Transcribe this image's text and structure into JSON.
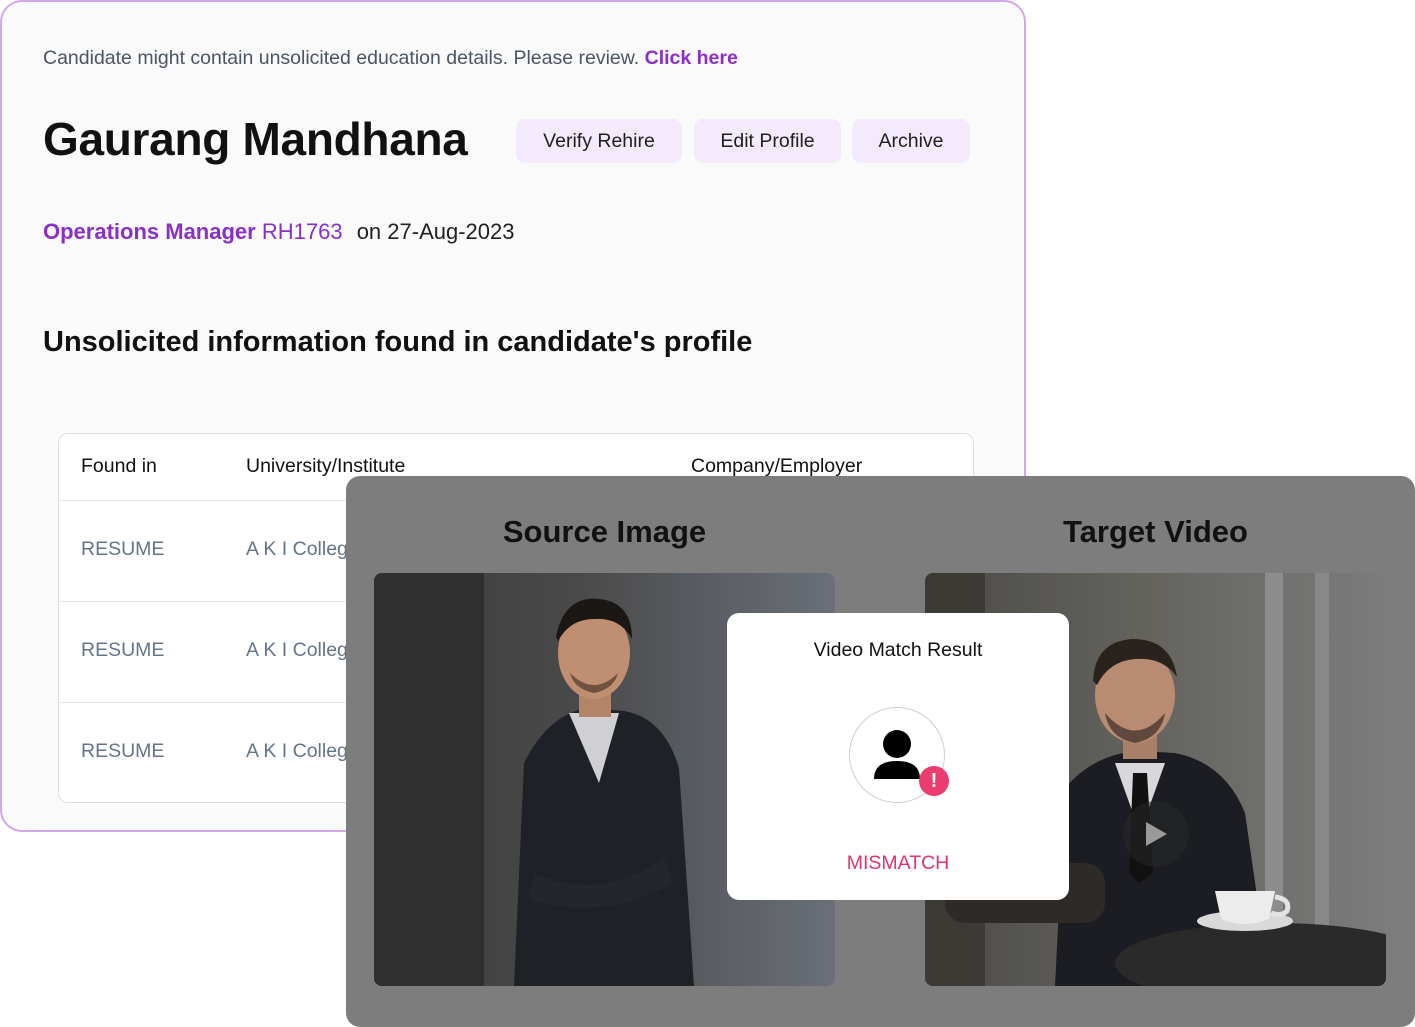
{
  "notice": {
    "text": "Candidate might contain unsolicited education details. Please review.",
    "link": "Click here"
  },
  "candidate": {
    "name": "Gaurang Mandhana",
    "job_title": "Operations Manager",
    "req_id": "RH1763",
    "date": "on 27-Aug-2023"
  },
  "actions": {
    "verify": "Verify Rehire",
    "edit": "Edit Profile",
    "archive": "Archive"
  },
  "section_title": "Unsolicited information found in candidate's profile",
  "table": {
    "headers": [
      "Found in",
      "University/Institute",
      "Company/Employer"
    ],
    "rows": [
      {
        "found_in": "RESUME",
        "institute": "A K I College"
      },
      {
        "found_in": "RESUME",
        "institute": "A K I College"
      },
      {
        "found_in": "RESUME",
        "institute": "A K I College"
      }
    ]
  },
  "video_match": {
    "source_title": "Source Image",
    "target_title": "Target Video",
    "result_title": "Video Match Result",
    "status": "MISMATCH",
    "status_color": "#e5336a",
    "icons": [
      "user-icon",
      "alert-icon",
      "play-icon"
    ]
  },
  "colors": {
    "accent": "#8b2fc9",
    "card_border": "#d4a6ea",
    "button_bg": "#f3ebfb",
    "overlay_bg": "#7d7d7d"
  }
}
